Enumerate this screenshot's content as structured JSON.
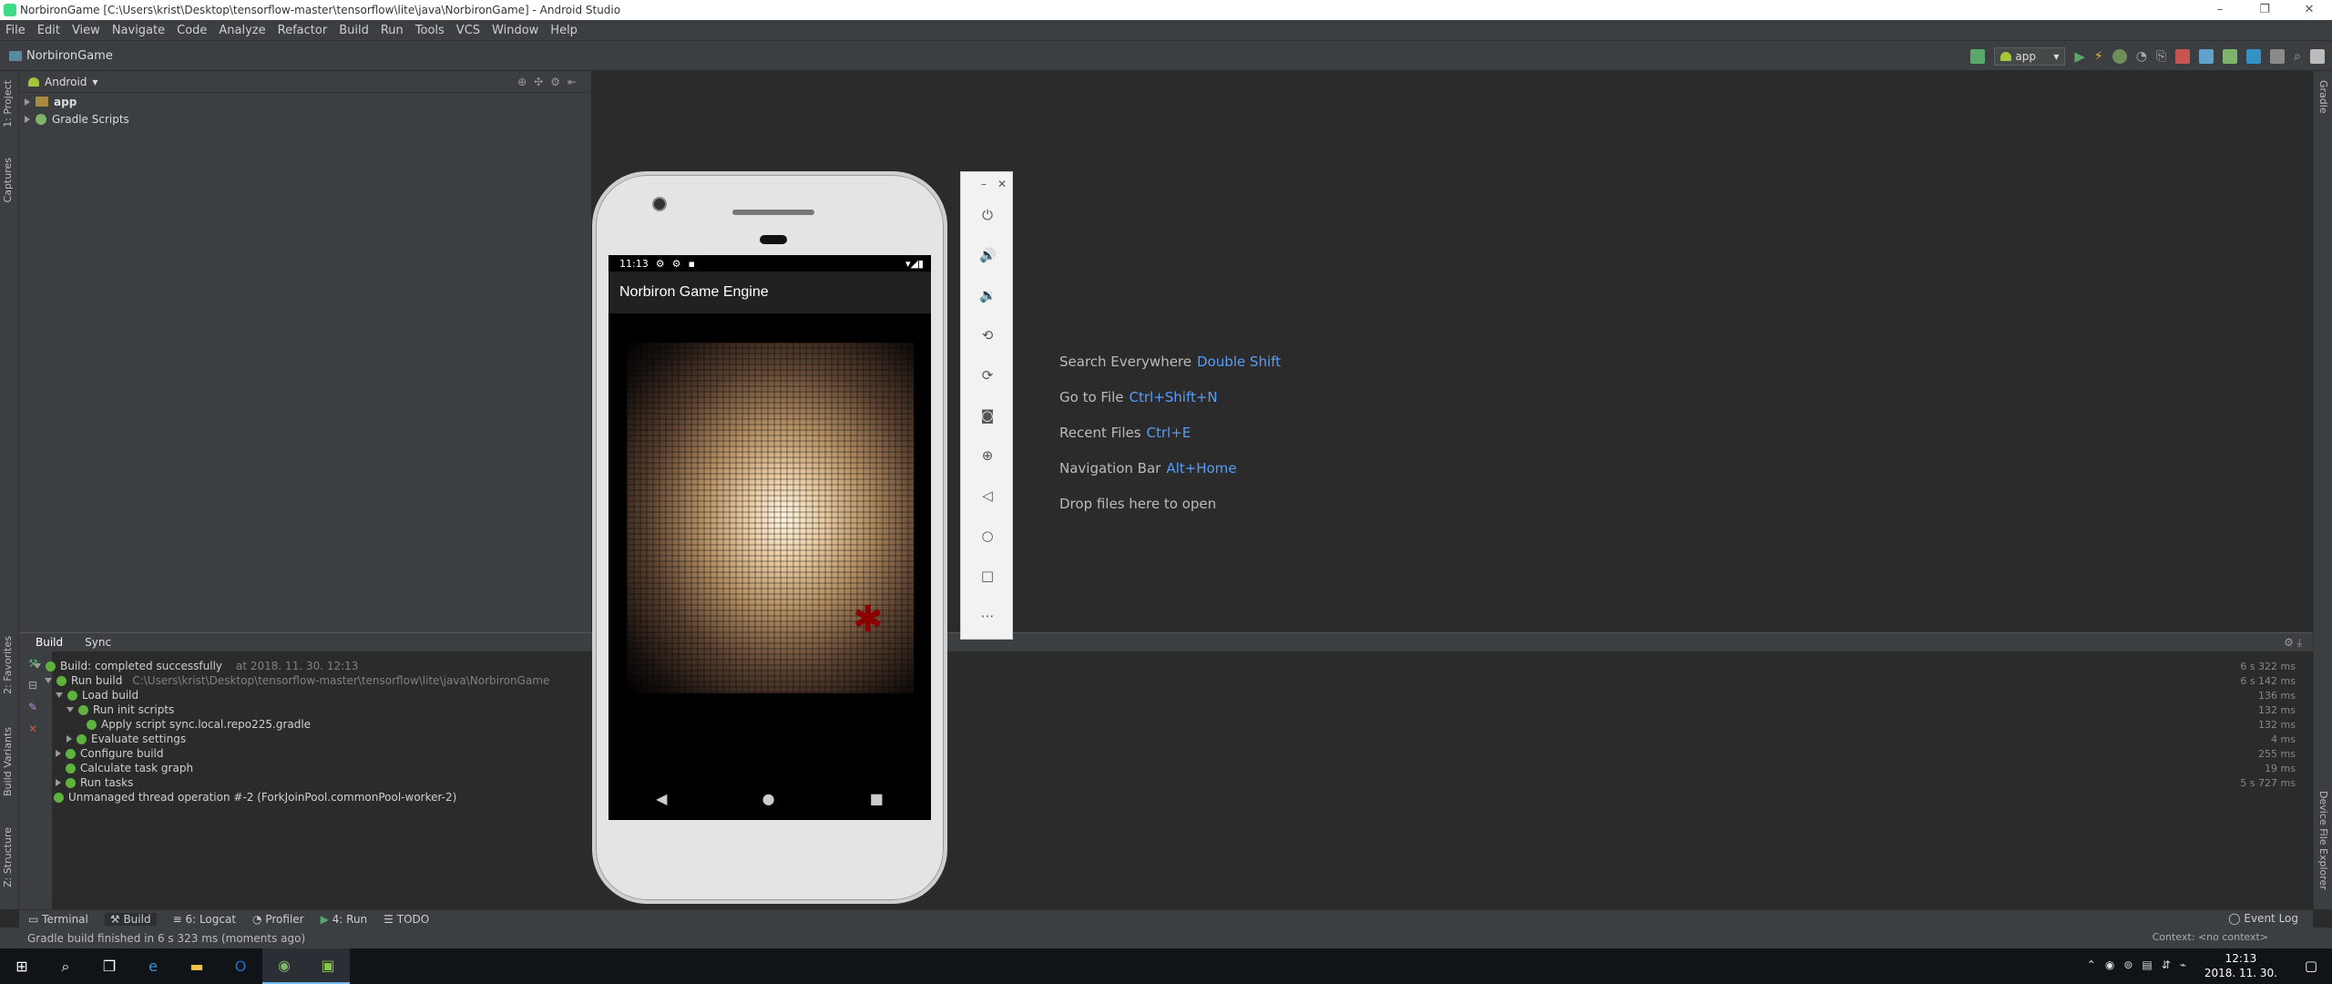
{
  "window": {
    "title": "NorbironGame [C:\\Users\\krist\\Desktop\\tensorflow-master\\tensorflow\\lite\\java\\NorbironGame] - Android Studio",
    "minimize": "–",
    "maximize": "❐",
    "close": "✕"
  },
  "menu": [
    "File",
    "Edit",
    "View",
    "Navigate",
    "Code",
    "Analyze",
    "Refactor",
    "Build",
    "Run",
    "Tools",
    "VCS",
    "Window",
    "Help"
  ],
  "navbar": {
    "project": "NorbironGame",
    "run_config": "app"
  },
  "left_stripe": {
    "project_tab": "1: Project",
    "captures_tab": "Captures",
    "favorites_tab": "2: Favorites",
    "build_variants_tab": "Build Variants",
    "structure_tab": "Z: Structure"
  },
  "right_stripe": {
    "gradle_tab": "Gradle",
    "device_file_explorer_tab": "Device File Explorer"
  },
  "project_panel": {
    "view_mode": "Android",
    "tree": [
      {
        "label": "app"
      },
      {
        "label": "Gradle Scripts"
      }
    ]
  },
  "editor": {
    "hints": [
      {
        "label": "Search Everywhere",
        "key": "Double Shift"
      },
      {
        "label": "Go to File",
        "key": "Ctrl+Shift+N"
      },
      {
        "label": "Recent Files",
        "key": "Ctrl+E"
      },
      {
        "label": "Navigation Bar",
        "key": "Alt+Home"
      },
      {
        "label": "Drop files here to open",
        "key": ""
      }
    ]
  },
  "build_panel": {
    "tabs": [
      "Build",
      "Sync"
    ],
    "rows": [
      {
        "text": "Build: completed successfully",
        "detail": "at 2018. 11. 30. 12:13",
        "time": "6 s 322 ms"
      },
      {
        "text": "Run build",
        "detail": "C:\\Users\\krist\\Desktop\\tensorflow-master\\tensorflow\\lite\\java\\NorbironGame",
        "time": "6 s 142 ms"
      },
      {
        "text": "Load build",
        "detail": "",
        "time": "136 ms"
      },
      {
        "text": "Run init scripts",
        "detail": "",
        "time": "132 ms"
      },
      {
        "text": "Apply script sync.local.repo225.gradle",
        "detail": "",
        "time": "132 ms"
      },
      {
        "text": "Evaluate settings",
        "detail": "",
        "time": "4 ms"
      },
      {
        "text": "Configure build",
        "detail": "",
        "time": "255 ms"
      },
      {
        "text": "Calculate task graph",
        "detail": "",
        "time": "19 ms"
      },
      {
        "text": "Run tasks",
        "detail": "",
        "time": "5 s 727 ms"
      },
      {
        "text": "Unmanaged thread operation #-2 (ForkJoinPool.commonPool-worker-2)",
        "detail": "",
        "time": ""
      }
    ]
  },
  "bottom_tabs": [
    "Terminal",
    "Build",
    "6: Logcat",
    "Profiler",
    "4: Run",
    "TODO"
  ],
  "event_log": "Event Log",
  "status": {
    "message": "Gradle build finished in 6 s 323 ms (moments ago)",
    "context": "Context: <no context>"
  },
  "phone": {
    "time": "11:13",
    "app_title": "Norbiron Game Engine"
  },
  "taskbar": {
    "time": "12:13",
    "date": "2018. 11. 30."
  },
  "colors": {
    "accent": "#589df6",
    "success": "#5fb23e",
    "run_green": "#59a869"
  }
}
